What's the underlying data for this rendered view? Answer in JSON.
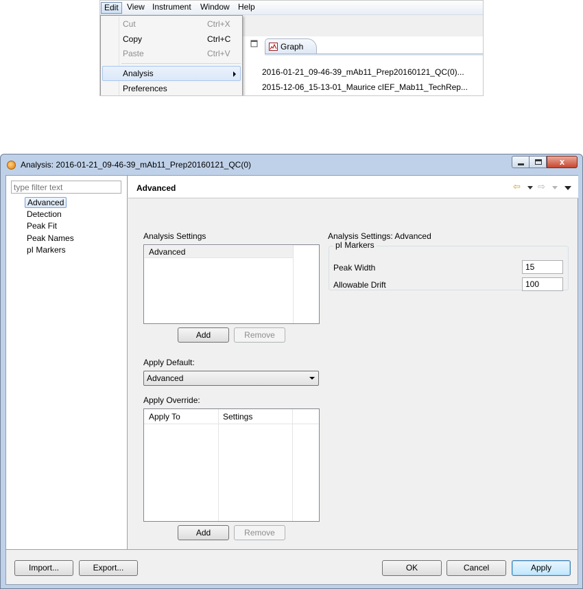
{
  "menubar": {
    "items": [
      "Edit",
      "View",
      "Instrument",
      "Window",
      "Help"
    ]
  },
  "edit_menu": {
    "items": [
      {
        "label": "Cut",
        "shortcut": "Ctrl+X"
      },
      {
        "label": "Copy",
        "shortcut": "Ctrl+C"
      },
      {
        "label": "Paste",
        "shortcut": "Ctrl+V"
      },
      {
        "label": "Analysis",
        "shortcut": ""
      },
      {
        "label": "Preferences",
        "shortcut": ""
      }
    ]
  },
  "analysis_submenu": {
    "items": [
      "2016-01-21_09-46-39_mAb11_Prep20160121_QC(0)...",
      "2015-12-06_15-13-01_Maurice cIEF_Mab11_TechRep..."
    ]
  },
  "editor_tab": {
    "label": "Graph"
  },
  "dialog": {
    "title": "Analysis: 2016-01-21_09-46-39_mAb11_Prep20160121_QC(0)",
    "close_glyph": "x"
  },
  "left_pane": {
    "filter_placeholder": "type filter text",
    "tree": [
      "Advanced",
      "Detection",
      "Peak Fit",
      "Peak Names",
      "pI Markers"
    ]
  },
  "page": {
    "title": "Advanced",
    "back_arrow": "⇦",
    "forward_arrow": "⇨"
  },
  "analysis_settings": {
    "label": "Analysis Settings",
    "rows": [
      "Advanced"
    ],
    "add_label": "Add",
    "remove_label": "Remove"
  },
  "apply_default": {
    "label": "Apply Default:",
    "value": "Advanced"
  },
  "apply_override": {
    "label": "Apply Override:",
    "columns": [
      "Apply To",
      "Settings"
    ],
    "add_label": "Add",
    "remove_label": "Remove"
  },
  "advanced_settings": {
    "label": "Analysis Settings: Advanced",
    "group_title": "pI Markers",
    "peak_width_label": "Peak Width",
    "peak_width_value": "15",
    "allowable_drift_label": "Allowable Drift",
    "allowable_drift_value": "100"
  },
  "footer": {
    "import_label": "Import...",
    "export_label": "Export...",
    "ok_label": "OK",
    "cancel_label": "Cancel",
    "apply_label": "Apply"
  }
}
